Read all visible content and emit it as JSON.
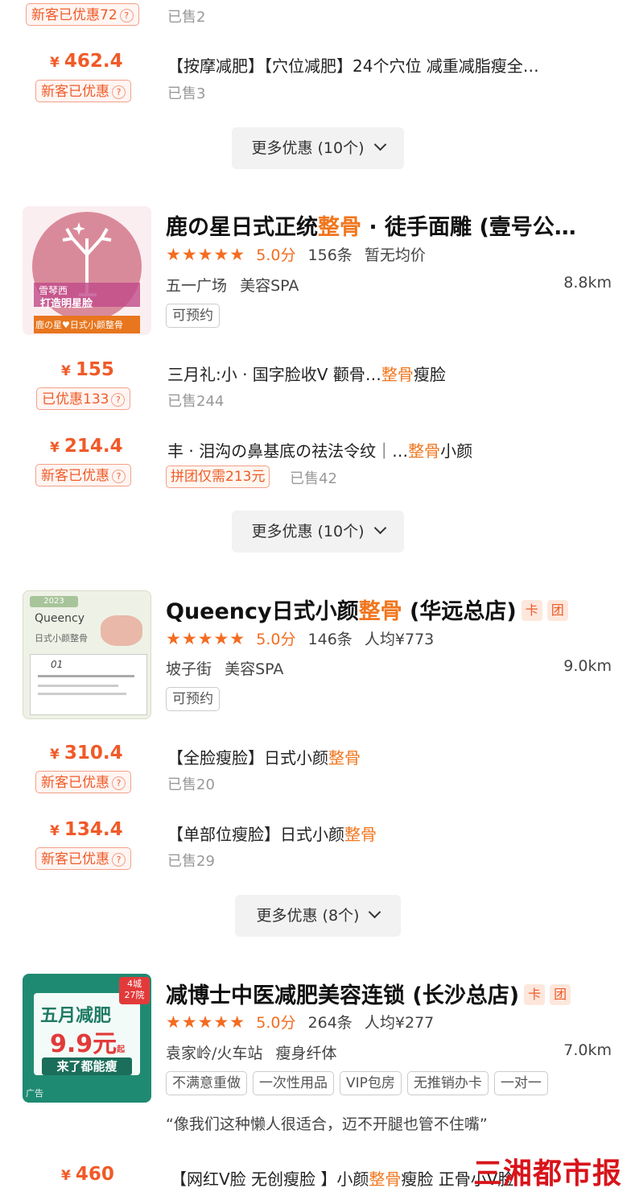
{
  "top_partial": {
    "badge": "新客已优惠72",
    "sold": "已售2"
  },
  "shops": [
    {
      "deals": [
        {
          "price": "462.4",
          "badge": "新客已优惠",
          "title": "【按摩减肥】【穴位减肥】24个穴位 减重减脂瘦全…",
          "sold": "已售3"
        }
      ],
      "more": "更多优惠 (10个)"
    },
    {
      "name_pre": "鹿の星日式正统",
      "name_hl": "整骨",
      "name_post": " · 徒手面雕 (壹号公…",
      "stars": "★★★★★",
      "score": "5.0分",
      "reviews": "156条",
      "avg": "暂无均价",
      "area": "五一广场",
      "category": "美容SPA",
      "distance": "8.8km",
      "tags": [
        "可预约"
      ],
      "thumb_text": [
        "雪琴西",
        "打造明星脸",
        "鹿の星♥日式小颜整骨"
      ],
      "deals": [
        {
          "price": "155",
          "badge": "已优惠133",
          "title_pre": "三月礼:小 · 国字脸收V 颧骨…",
          "title_hl": "整骨",
          "title_post": "瘦脸",
          "sold": "已售244"
        },
        {
          "price": "214.4",
          "badge": "新客已优惠",
          "title_pre": "丰 · 泪沟の鼻基底の祛法令纹｜…",
          "title_hl": "整骨",
          "title_post": "小颜",
          "group": "拼团仅需213元",
          "sold": "已售42"
        }
      ],
      "more": "更多优惠 (10个)"
    },
    {
      "name_pre": "Queency日式小颜",
      "name_hl": "整骨",
      "name_post": " (华远总店)",
      "badge_card": "卡",
      "badge_group": "团",
      "stars": "★★★★★",
      "score": "5.0分",
      "reviews": "146条",
      "avg": "人均¥773",
      "area": "坡子街",
      "category": "美容SPA",
      "distance": "9.0km",
      "tags": [
        "可预约"
      ],
      "thumb_text": [
        "2023",
        "Queency",
        "日式小颜整骨",
        "01"
      ],
      "deals": [
        {
          "price": "310.4",
          "badge": "新客已优惠",
          "title_pre": "【全脸瘦脸】日式小颜",
          "title_hl": "整骨",
          "title_post": "",
          "sold": "已售20"
        },
        {
          "price": "134.4",
          "badge": "新客已优惠",
          "title_pre": "【单部位瘦脸】日式小颜",
          "title_hl": "整骨",
          "title_post": "",
          "sold": "已售29"
        }
      ],
      "more": "更多优惠 (8个)"
    },
    {
      "name": "减博士中医减肥美容连锁 (长沙总店)",
      "badge_card": "卡",
      "badge_group": "团",
      "stars": "★★★★★",
      "score": "5.0分",
      "reviews": "264条",
      "avg": "人均¥277",
      "area": "袁家岭/火车站",
      "category": "瘦身纤体",
      "distance": "7.0km",
      "tags": [
        "不满意重做",
        "一次性用品",
        "VIP包房",
        "无推销办卡",
        "一对一"
      ],
      "quote": "“像我们这种懒人很适合，迈不开腿也管不住嘴”",
      "thumb_text": [
        "4城",
        "27院",
        "五月减肥",
        "9.9元",
        "起",
        "来了都能瘦",
        "广告"
      ],
      "deals": [
        {
          "price": "460",
          "title_pre": "【网红V脸 无创瘦脸 】小颜",
          "title_hl": "整骨",
          "title_post": "瘦脸 正骨小V脸"
        }
      ]
    }
  ],
  "watermark": "三湘都市报",
  "colors": {
    "accent": "#f05a28",
    "highlight": "#f0761e",
    "star": "#f36c21",
    "watermark": "#d8141b"
  },
  "icons": {
    "question": "question-circle-icon",
    "chevron": "chevron-down-icon",
    "star": "star-icon"
  }
}
